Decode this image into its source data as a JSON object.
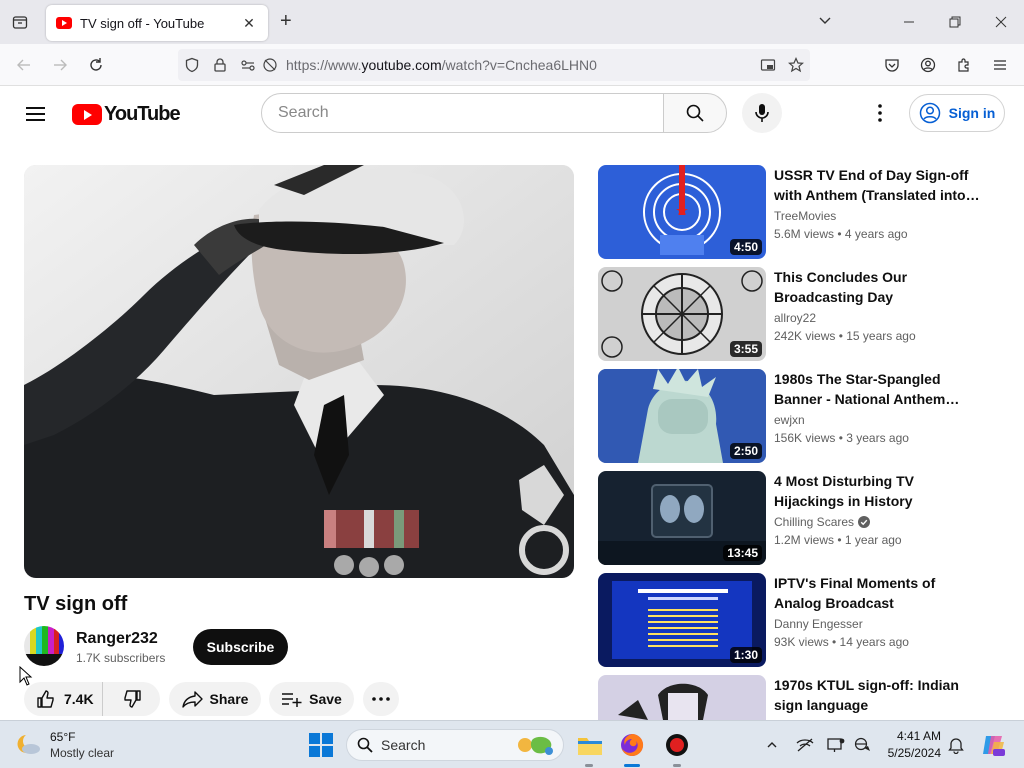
{
  "browser": {
    "tab_title": "TV sign off - YouTube",
    "url_prefix": "https://www.",
    "url_host": "youtube.com",
    "url_path": "/watch?v=Cnchea6LHN0"
  },
  "header": {
    "logo_text": "YouTube",
    "search_placeholder": "Search",
    "signin_label": "Sign in"
  },
  "video": {
    "title": "TV sign off",
    "channel": "Ranger232",
    "subscribers": "1.7K subscribers",
    "subscribe_label": "Subscribe",
    "likes": "7.4K",
    "share_label": "Share",
    "save_label": "Save"
  },
  "recommendations": [
    {
      "title": "USSR TV End of Day Sign-off with Anthem (Translated into…",
      "channel": "TreeMovies",
      "meta": "5.6M views • 4 years ago",
      "duration": "4:50",
      "verified": false
    },
    {
      "title": "This Concludes Our Broadcasting Day",
      "channel": "allroy22",
      "meta": "242K views • 15 years ago",
      "duration": "3:55",
      "verified": false
    },
    {
      "title": "1980s The Star-Spangled Banner - National Anthem…",
      "channel": "ewjxn",
      "meta": "156K views • 3 years ago",
      "duration": "2:50",
      "verified": false
    },
    {
      "title": "4 Most Disturbing TV Hijackings in History",
      "channel": "Chilling Scares",
      "meta": "1.2M views • 1 year ago",
      "duration": "13:45",
      "verified": true
    },
    {
      "title": "IPTV's Final Moments of Analog Broadcast",
      "channel": "Danny Engesser",
      "meta": "93K views • 14 years ago",
      "duration": "1:30",
      "verified": false
    },
    {
      "title": "1970s KTUL sign-off: Indian sign language",
      "channel": "",
      "meta": "",
      "duration": "",
      "verified": false
    }
  ],
  "taskbar": {
    "weather_temp": "65°F",
    "weather_desc": "Mostly clear",
    "search_label": "Search",
    "time": "4:41 AM",
    "date": "5/25/2024"
  },
  "colors": {
    "yt_red": "#ff0000",
    "link_blue": "#065fd4",
    "win_blue": "#0a78d7"
  }
}
